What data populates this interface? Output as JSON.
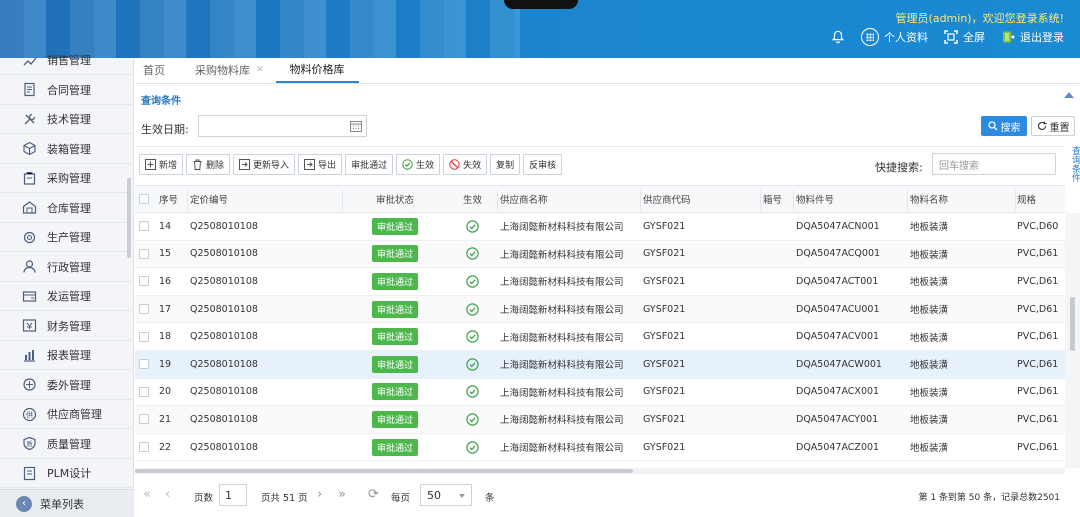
{
  "header": {
    "welcome": "管理员(admin)，欢迎您登录系统!",
    "actions": [
      {
        "label": ""
      },
      {
        "label": "个人资料"
      },
      {
        "label": "全屏"
      },
      {
        "label": "退出登录"
      }
    ]
  },
  "sidebar": {
    "items": [
      {
        "label": "销售管理",
        "icon": "sales-icon"
      },
      {
        "label": "合同管理",
        "icon": "contract-icon"
      },
      {
        "label": "技术管理",
        "icon": "tools-icon"
      },
      {
        "label": "装箱管理",
        "icon": "box-icon"
      },
      {
        "label": "采购管理",
        "icon": "purchase-icon"
      },
      {
        "label": "仓库管理",
        "icon": "warehouse-icon"
      },
      {
        "label": "生产管理",
        "icon": "production-icon"
      },
      {
        "label": "行政管理",
        "icon": "admin-icon"
      },
      {
        "label": "发运管理",
        "icon": "shipping-icon"
      },
      {
        "label": "财务管理",
        "icon": "finance-icon"
      },
      {
        "label": "报表管理",
        "icon": "report-icon"
      },
      {
        "label": "委外管理",
        "icon": "outsource-icon"
      },
      {
        "label": "供应商管理",
        "icon": "supplier-icon"
      },
      {
        "label": "质量管理",
        "icon": "quality-icon"
      },
      {
        "label": "PLM设计",
        "icon": "plm-icon"
      }
    ],
    "footer_label": "菜单列表"
  },
  "tabs": [
    {
      "label": "首页",
      "closable": false
    },
    {
      "label": "采购物料库",
      "closable": true
    },
    {
      "label": "物料价格库",
      "closable": true
    }
  ],
  "query": {
    "title": "查询条件",
    "date_label": "生效日期:",
    "search_label": "搜索",
    "reset_label": "重置",
    "side_tag": "查询条件"
  },
  "toolbar": {
    "buttons": [
      "新增",
      "删除",
      "更新导入",
      "导出",
      "审批通过",
      "生效",
      "失效",
      "复制",
      "反审核"
    ],
    "quick_label": "快捷搜索:",
    "quick_placeholder": "回车搜索"
  },
  "table": {
    "columns": [
      "序号",
      "定价编号",
      "审批状态",
      "生效",
      "供应商名称",
      "供应商代码",
      "箱号",
      "物料件号",
      "物料名称",
      "规格"
    ],
    "rows": [
      {
        "no": "14",
        "code": "Q2508010108",
        "status": "审批通过",
        "supplier": "上海阔懿新材料科技有限公司",
        "supplier_code": "GYSF021",
        "box": "",
        "part": "DQA5047ACN001",
        "name": "地板装潢",
        "spec": "PVC,D60"
      },
      {
        "no": "15",
        "code": "Q2508010108",
        "status": "审批通过",
        "supplier": "上海阔懿新材料科技有限公司",
        "supplier_code": "GYSF021",
        "box": "",
        "part": "DQA5047ACQ001",
        "name": "地板装潢",
        "spec": "PVC,D61"
      },
      {
        "no": "16",
        "code": "Q2508010108",
        "status": "审批通过",
        "supplier": "上海阔懿新材料科技有限公司",
        "supplier_code": "GYSF021",
        "box": "",
        "part": "DQA5047ACT001",
        "name": "地板装潢",
        "spec": "PVC,D61"
      },
      {
        "no": "17",
        "code": "Q2508010108",
        "status": "审批通过",
        "supplier": "上海阔懿新材料科技有限公司",
        "supplier_code": "GYSF021",
        "box": "",
        "part": "DQA5047ACU001",
        "name": "地板装潢",
        "spec": "PVC,D61"
      },
      {
        "no": "18",
        "code": "Q2508010108",
        "status": "审批通过",
        "supplier": "上海阔懿新材料科技有限公司",
        "supplier_code": "GYSF021",
        "box": "",
        "part": "DQA5047ACV001",
        "name": "地板装潢",
        "spec": "PVC,D61"
      },
      {
        "no": "19",
        "code": "Q2508010108",
        "status": "审批通过",
        "supplier": "上海阔懿新材料科技有限公司",
        "supplier_code": "GYSF021",
        "box": "",
        "part": "DQA5047ACW001",
        "name": "地板装潢",
        "spec": "PVC,D61"
      },
      {
        "no": "20",
        "code": "Q2508010108",
        "status": "审批通过",
        "supplier": "上海阔懿新材料科技有限公司",
        "supplier_code": "GYSF021",
        "box": "",
        "part": "DQA5047ACX001",
        "name": "地板装潢",
        "spec": "PVC,D61"
      },
      {
        "no": "21",
        "code": "Q2508010108",
        "status": "审批通过",
        "supplier": "上海阔懿新材料科技有限公司",
        "supplier_code": "GYSF021",
        "box": "",
        "part": "DQA5047ACY001",
        "name": "地板装潢",
        "spec": "PVC,D61"
      },
      {
        "no": "22",
        "code": "Q2508010108",
        "status": "审批通过",
        "supplier": "上海阔懿新材料科技有限公司",
        "supplier_code": "GYSF021",
        "box": "",
        "part": "DQA5047ACZ001",
        "name": "地板装潢",
        "spec": "PVC,D61"
      }
    ],
    "selected_row": "19"
  },
  "pager": {
    "page_label": "页数",
    "page_value": "1",
    "total_pages": "页共 51 页",
    "per_page_label": "每页",
    "per_page_value": "50",
    "unit": "条",
    "summary": "第 1 条到第 50 条，记录总数2501"
  },
  "colors": {
    "header": "#1b86cf",
    "accent": "#2b8be0",
    "approved_badge": "#4cb84c",
    "welcome_text": "#ffe77a"
  }
}
